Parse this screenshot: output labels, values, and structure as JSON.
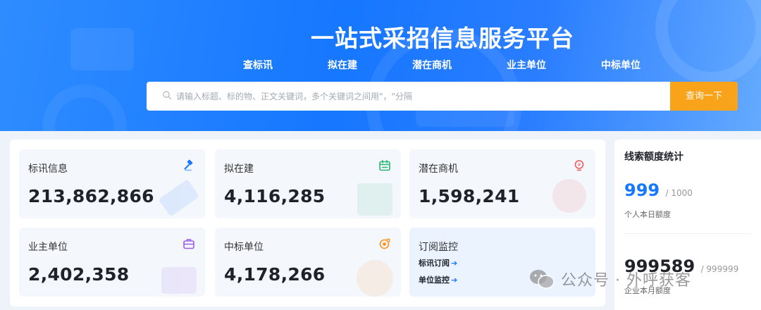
{
  "hero": {
    "title": "一站式采招信息服务平台",
    "tabs": [
      {
        "label": "查标讯",
        "active": true
      },
      {
        "label": "拟在建",
        "active": false
      },
      {
        "label": "潜在商机",
        "active": false
      },
      {
        "label": "业主单位",
        "active": false
      },
      {
        "label": "中标单位",
        "active": false
      }
    ],
    "search": {
      "placeholder": "请输入标题、标的物、正文关键词，多个关键词之间用\"，\"分隔",
      "button_label": "查询一下"
    }
  },
  "stats": {
    "cards": [
      {
        "label": "标讯信息",
        "value": "213,862,866",
        "icon": "gavel-icon",
        "icon_color": "#1677ff"
      },
      {
        "label": "拟在建",
        "value": "4,116,285",
        "icon": "calendar-icon",
        "icon_color": "#2bb673"
      },
      {
        "label": "潜在商机",
        "value": "1,598,241",
        "icon": "lightbulb-icon",
        "icon_color": "#f05a5a"
      },
      {
        "label": "业主单位",
        "value": "2,402,358",
        "icon": "briefcase-icon",
        "icon_color": "#9b5de5"
      },
      {
        "label": "中标单位",
        "value": "4,178,266",
        "icon": "award-icon",
        "icon_color": "#f7931e"
      }
    ],
    "subscribe": {
      "label": "订阅监控",
      "links": [
        "标讯订阅",
        "单位监控"
      ]
    }
  },
  "quota": {
    "title": "线索额度统计",
    "personal": {
      "used": "999",
      "total": "/ 1000",
      "label": "个人本日额度"
    },
    "enterprise": {
      "used": "999589",
      "total": "/ 999999",
      "label": "企业本月额度"
    }
  },
  "watermark": {
    "text": "公众号 · 外呼获客",
    "icon": "wechat-icon"
  },
  "colors": {
    "brand": "#1677ff",
    "accent": "#f9a31b",
    "quota_number": "#1677ff"
  }
}
